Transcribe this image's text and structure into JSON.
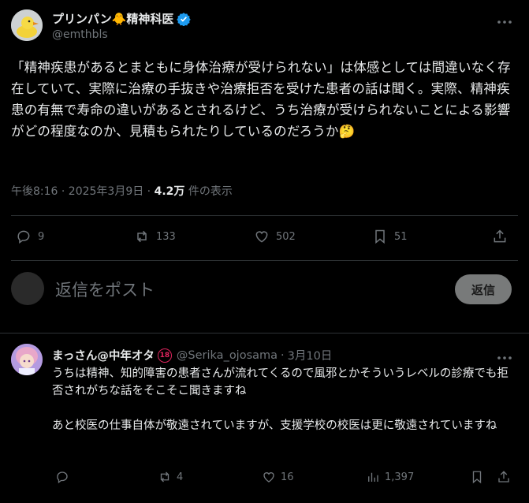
{
  "post": {
    "author_name": "プリンパン🐥精神科医",
    "handle": "@emthbls",
    "text": "「精神疾患があるとまともに身体治療が受けられない」は体感としては間違いなく存在していて、実際に治療の手抜きや治療拒否を受けた患者の話は聞く。実際、精神疾患の有無で寿命の違いがあるとされるけど、うち治療が受けられないことによる影響がどの程度なのか、見積もられたりしているのだろうか🤔",
    "timestamp": "午後8:16 · 2025年3月9日 · ",
    "views_count": "4.2万",
    "views_suffix": " 件の表示",
    "stats": {
      "replies": "9",
      "reposts": "133",
      "likes": "502",
      "bookmarks": "51"
    }
  },
  "reply_box": {
    "placeholder": "返信をポスト",
    "button": "返信"
  },
  "reply": {
    "author_name": "まっさん@中年オタ",
    "age_badge": "18",
    "handle": "@Serika_ojosama",
    "separator": "·",
    "date": "3月10日",
    "text_p1": "うちは精神、知的障害の患者さんが流れてくるので風邪とかそういうレベルの診療でも拒否されがちな話をそこそこ聞きますね",
    "text_p2": "あと校医の仕事自体が敬遠されていますが、支援学校の校医は更に敬遠されていますね",
    "stats": {
      "reposts": "4",
      "likes": "16",
      "views": "1,397"
    }
  },
  "colors": {
    "verified": "#1d9bf0",
    "muted": "#71767b",
    "divider": "#2f3336",
    "reply_button_bg": "#787a7a"
  }
}
